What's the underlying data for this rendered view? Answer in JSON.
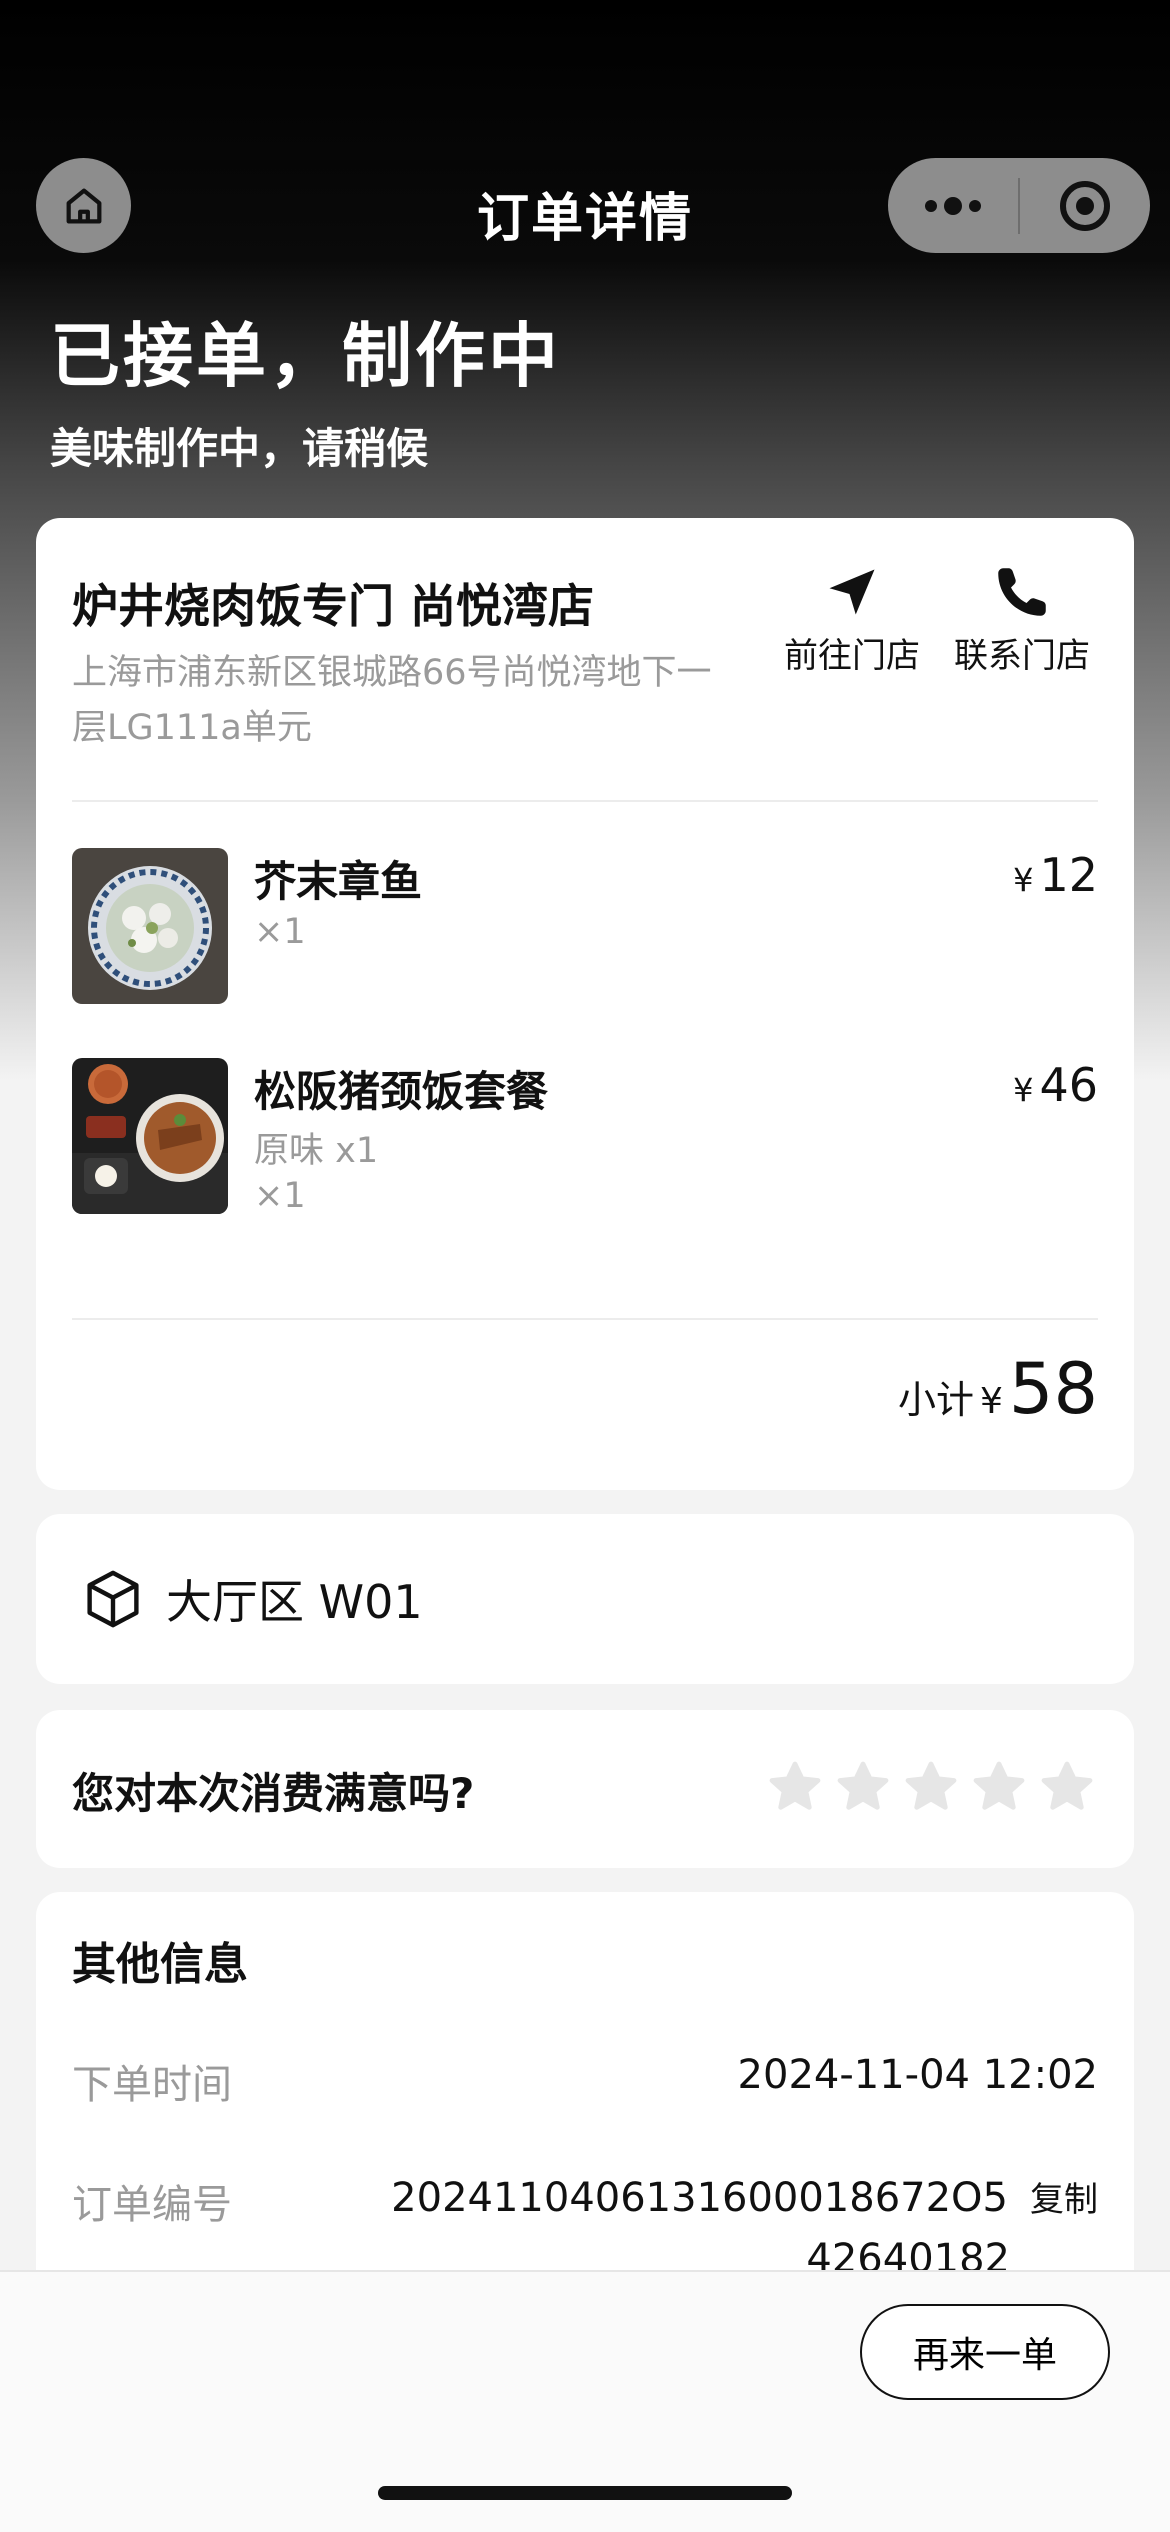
{
  "nav": {
    "title": "订单详情"
  },
  "order_status": {
    "title": "已接单，制作中",
    "subtitle": "美味制作中，请稍候"
  },
  "store": {
    "name": "炉井烧肉饭专门 尚悦湾店",
    "address": "上海市浦东新区银城路66号尚悦湾地下一层LG111a单元",
    "navigate_label": "前往门店",
    "contact_label": "联系门店"
  },
  "items": [
    {
      "name": "芥末章鱼",
      "spec": "",
      "qty": "×1",
      "currency": "¥",
      "price": "12"
    },
    {
      "name": "松阪猪颈饭套餐",
      "spec": "原味 x1",
      "qty": "×1",
      "currency": "¥",
      "price": "46"
    }
  ],
  "subtotal": {
    "label": "小计",
    "currency": "¥",
    "amount": "58"
  },
  "table": {
    "icon": "cube-icon",
    "label": "大厅区 W01"
  },
  "rating": {
    "question": "您对本次消费满意吗?",
    "stars_total": 5,
    "stars_selected": 0
  },
  "other_info": {
    "title": "其他信息",
    "order_time_label": "下单时间",
    "order_time": "2024-11-04 12:02",
    "order_no_label": "订单编号",
    "order_no": "20241104061316000186720542640182",
    "order_no_line1": "2024110406131600018672O5",
    "order_no_line2": "42640182",
    "copy_label": "复制"
  },
  "bottom": {
    "reorder_label": "再来一单"
  },
  "colors": {
    "muted": "#9a9a9a",
    "capsule": "#8d8d8d",
    "star": "#e6e6e6"
  }
}
